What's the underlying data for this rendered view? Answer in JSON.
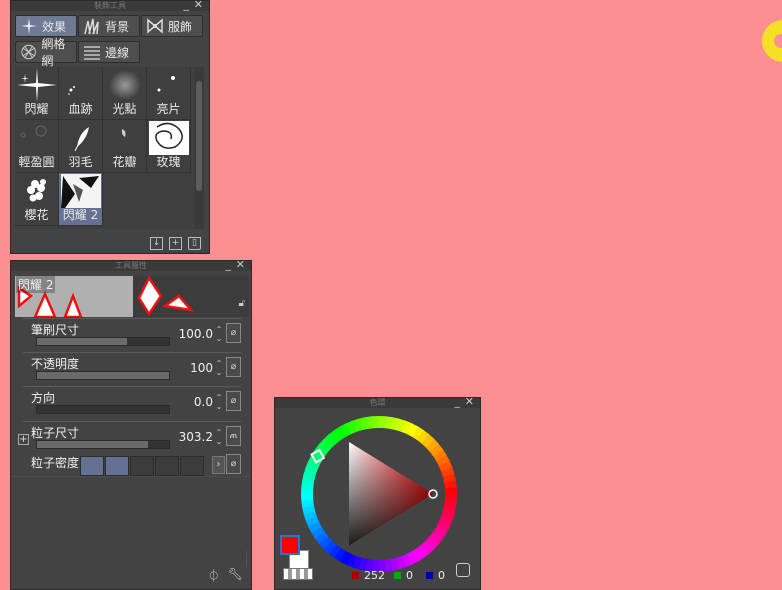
{
  "subtool_panel": {
    "title": "裝飾工具",
    "tabs": [
      {
        "label": "效果",
        "icon": "sparkle-icon",
        "active": true
      },
      {
        "label": "背景",
        "icon": "grass-icon",
        "active": false
      },
      {
        "label": "服飾",
        "icon": "bow-icon",
        "active": false
      },
      {
        "label": "網格網",
        "icon": "mesh-icon",
        "active": false
      },
      {
        "label": "邊線",
        "icon": "lines-icon",
        "active": false
      }
    ],
    "tools": [
      "閃耀",
      "血跡",
      "光點",
      "亮片",
      "輕盈圓",
      "羽毛",
      "花瓣",
      "玫瑰",
      "櫻花",
      "閃耀 2"
    ],
    "selected_tool": "閃耀 2"
  },
  "toolprop_panel": {
    "title": "工具屬性",
    "preview_title": "閃耀 2",
    "properties": [
      {
        "name": "筆刷尺寸",
        "value": "100.0",
        "fill": 0.6
      },
      {
        "name": "不透明度",
        "value": "100",
        "fill": 1.0
      },
      {
        "name": "方向",
        "value": "0.0",
        "fill": 0.0
      },
      {
        "name": "粒子尺寸",
        "value": "303.2",
        "fill": 0.8
      }
    ],
    "density_label": "粒子密度",
    "density_steps_on": 2
  },
  "color_panel": {
    "title": "色環",
    "rgb": {
      "r": "252",
      "g": "0",
      "b": "0"
    },
    "colors": {
      "main": "#fc0000",
      "sub": "#ffffff",
      "canvas": "#fc8f92"
    }
  }
}
